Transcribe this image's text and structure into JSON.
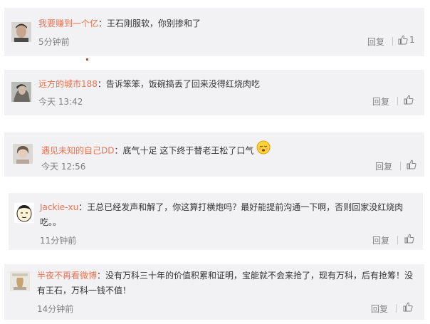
{
  "comments": [
    {
      "username": "我要赚到一个亿",
      "separator": "：",
      "text": "王石刚服软，你别掺和了",
      "time": "5分钟前",
      "reply_label": "回复",
      "like_count": "1",
      "avatar_icon": "man-face-avatar-icon"
    },
    {
      "username": "远方的城市188",
      "separator": "：",
      "text": "告诉笨笨，饭碗搞丢了回来没得红烧肉吃",
      "time": "今天 13:42",
      "reply_label": "回复",
      "avatar_icon": "woman-photo-avatar-icon"
    },
    {
      "username": "遇见未知的自己DD",
      "separator": "：",
      "text": "底气十足 这下终于替老王松了口气",
      "time": "今天 12:56",
      "reply_label": "回复",
      "emoji_icon": "relieved-face-emoji-icon",
      "avatar_icon": "girl-photo-avatar-icon"
    },
    {
      "username": "Jackie-xu",
      "separator": "：",
      "text": "王总已经发声和解了，你这算打横炮吗？最好能提前沟通一下啊，否则回家没红烧肉吃。。",
      "time": "11分钟前",
      "reply_label": "回复",
      "avatar_icon": "cartoon-face-avatar-icon"
    },
    {
      "username": "半夜不再看微博",
      "separator": "：",
      "text": "没有万科三十年的价值积累和证明，宝能就不会来抢了，现有万科，后有抢筹！没有王石，万科一钱不值！",
      "time": "14分钟前",
      "reply_label": "回复",
      "avatar_icon": "vase-photo-avatar-icon"
    }
  ],
  "colors": {
    "card_bg": "#f2f2f5",
    "username": "#eb7350",
    "text": "#333333",
    "meta": "#808080"
  }
}
